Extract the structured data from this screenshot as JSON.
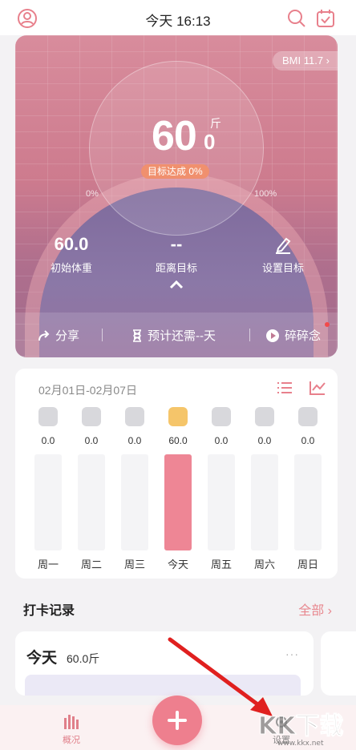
{
  "topbar": {
    "title": "今天 16:13"
  },
  "hero": {
    "bmi": "BMI 11.7 ›",
    "weight_int": "60",
    "weight_dec": "0",
    "weight_unit": "斤",
    "goal_pill": "目标达成 0%",
    "progress_left": "0%",
    "progress_right": "100%",
    "initial_value": "60.0",
    "initial_label": "初始体重",
    "distance_value": "--",
    "distance_label": "距离目标",
    "set_goal_label": "设置目标",
    "goal_progress": 0,
    "actions": {
      "share": "分享",
      "forecast": "预计还需--天",
      "notes": "碎碎念"
    }
  },
  "week": {
    "range": "02月01日-02月07日",
    "days": [
      {
        "label": "周一",
        "value": "0.0",
        "fill": 0,
        "today": false
      },
      {
        "label": "周二",
        "value": "0.0",
        "fill": 0,
        "today": false
      },
      {
        "label": "周三",
        "value": "0.0",
        "fill": 0,
        "today": false
      },
      {
        "label": "今天",
        "value": "60.0",
        "fill": 1,
        "today": true
      },
      {
        "label": "周五",
        "value": "0.0",
        "fill": 0,
        "today": false
      },
      {
        "label": "周六",
        "value": "0.0",
        "fill": 0,
        "today": false
      },
      {
        "label": "周日",
        "value": "0.0",
        "fill": 0,
        "today": false
      }
    ]
  },
  "records": {
    "title": "打卡记录",
    "all": "全部 ›",
    "entry": {
      "day": "今天",
      "weight": "60.0斤",
      "more": "···"
    }
  },
  "nav": {
    "overview": "概况",
    "settings": "设置"
  },
  "watermark": {
    "text": "KK下载",
    "url": "www.kkx.net"
  },
  "colors": {
    "accent": "#ee7f8e",
    "pill": "#f0906e",
    "arrow": "#e0201f"
  }
}
